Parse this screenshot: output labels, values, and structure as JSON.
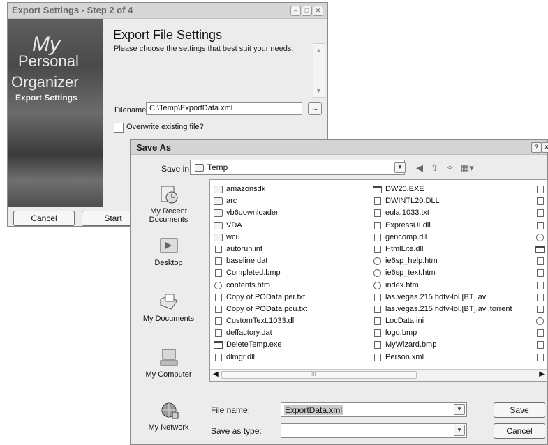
{
  "wizard": {
    "title": "Export Settings - Step 2 of 4",
    "brand": {
      "line1": "My",
      "line2": "Personal",
      "line3": "Organizer",
      "line4": "Export Settings"
    },
    "heading": "Export File Settings",
    "subtitle": "Please choose the settings that best suit your needs.",
    "filename_label": "Filename:",
    "filename_value": "C:\\Temp\\ExportData.xml",
    "browse_label": "...",
    "overwrite_label": "Overwrite existing file?",
    "overwrite_checked": false,
    "cancel_label": "Cancel",
    "start_label": "Start"
  },
  "save_as": {
    "title": "Save As",
    "save_in_label": "Save in:",
    "save_in_value": "Temp",
    "places": [
      {
        "label": "My Recent Documents",
        "icon": "recent-documents-icon"
      },
      {
        "label": "Desktop",
        "icon": "desktop-icon"
      },
      {
        "label": "My Documents",
        "icon": "my-documents-icon"
      },
      {
        "label": "My Computer",
        "icon": "my-computer-icon"
      },
      {
        "label": "My Network",
        "icon": "my-network-icon"
      }
    ],
    "files_col1": [
      {
        "name": "amazonsdk",
        "type": "folder"
      },
      {
        "name": "arc",
        "type": "folder"
      },
      {
        "name": "vb6downloader",
        "type": "folder"
      },
      {
        "name": "VDA",
        "type": "folder"
      },
      {
        "name": "wcu",
        "type": "folder"
      },
      {
        "name": "autorun.inf",
        "type": "file"
      },
      {
        "name": "baseline.dat",
        "type": "file"
      },
      {
        "name": "Completed.bmp",
        "type": "file"
      },
      {
        "name": "contents.htm",
        "type": "web"
      },
      {
        "name": "Copy of POData.per.txt",
        "type": "file"
      },
      {
        "name": "Copy of POData.pou.txt",
        "type": "file"
      },
      {
        "name": "CustomText.1033.dll",
        "type": "file"
      },
      {
        "name": "deffactory.dat",
        "type": "file"
      },
      {
        "name": "DeleteTemp.exe",
        "type": "exe"
      },
      {
        "name": "dlmgr.dll",
        "type": "file"
      }
    ],
    "files_col2": [
      {
        "name": "DW20.EXE",
        "type": "exe"
      },
      {
        "name": "DWINTL20.DLL",
        "type": "file"
      },
      {
        "name": "eula.1033.txt",
        "type": "file"
      },
      {
        "name": "ExpressUI.dll",
        "type": "file"
      },
      {
        "name": "gencomp.dll",
        "type": "file"
      },
      {
        "name": "HtmlLite.dll",
        "type": "file"
      },
      {
        "name": "ie6sp_help.htm",
        "type": "web"
      },
      {
        "name": "ie6sp_text.htm",
        "type": "web"
      },
      {
        "name": "index.htm",
        "type": "web"
      },
      {
        "name": "las.vegas.215.hdtv-lol.[BT].avi",
        "type": "file"
      },
      {
        "name": "las.vegas.215.hdtv-lol.[BT].avi.torrent",
        "type": "file"
      },
      {
        "name": "LocData.ini",
        "type": "file"
      },
      {
        "name": "logo.bmp",
        "type": "file"
      },
      {
        "name": "MyWizard.bmp",
        "type": "file"
      },
      {
        "name": "Person.xml",
        "type": "file"
      }
    ],
    "scroll_thumb_glyph": "III",
    "file_name_label": "File name:",
    "file_name_value": "ExportData.xml",
    "save_as_type_label": "Save as type:",
    "save_as_type_value": "",
    "save_label": "Save",
    "cancel_label": "Cancel"
  }
}
